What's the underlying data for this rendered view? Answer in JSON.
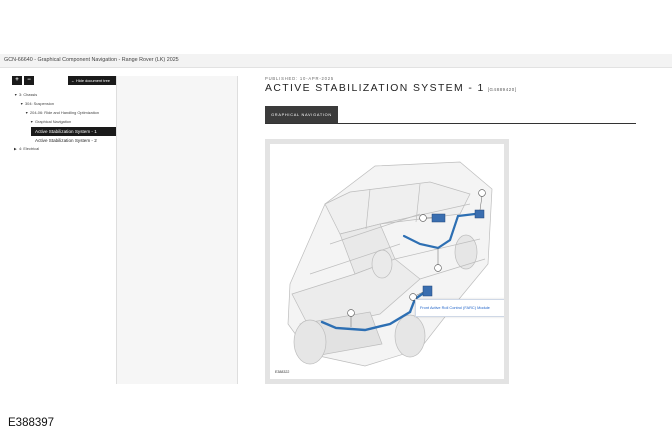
{
  "header": {
    "title": "GCN-66640 - Graphical Component Navigation - Range Rover (LK) 2025"
  },
  "tree": {
    "expand_label": "+",
    "collapse_label": "−",
    "hide_label": "Hide document tree",
    "hide_icon": "arrow-left-icon",
    "nodes": [
      {
        "label": "3: Chassis"
      },
      {
        "label": "304: Suspension"
      },
      {
        "label": "204-06: Ride and Handling Optimization"
      },
      {
        "label": "Graphical Navigation"
      },
      {
        "label": "Active Stabilization System - 1"
      },
      {
        "label": "Active Stabilization System - 2"
      },
      {
        "label": "4: Electrical"
      }
    ]
  },
  "document": {
    "published": "PUBLISHED: 10-APR-2025",
    "title": "ACTIVE STABILIZATION SYSTEM - 1",
    "doc_id": "[G4889420]",
    "tab_label": "GRAPHICAL NAVIGATION"
  },
  "figure": {
    "label": "E388322",
    "callout": "Front Active Roll Control (FARC) Module",
    "accent_color": "#2d6fb3"
  },
  "caption": "E388397"
}
